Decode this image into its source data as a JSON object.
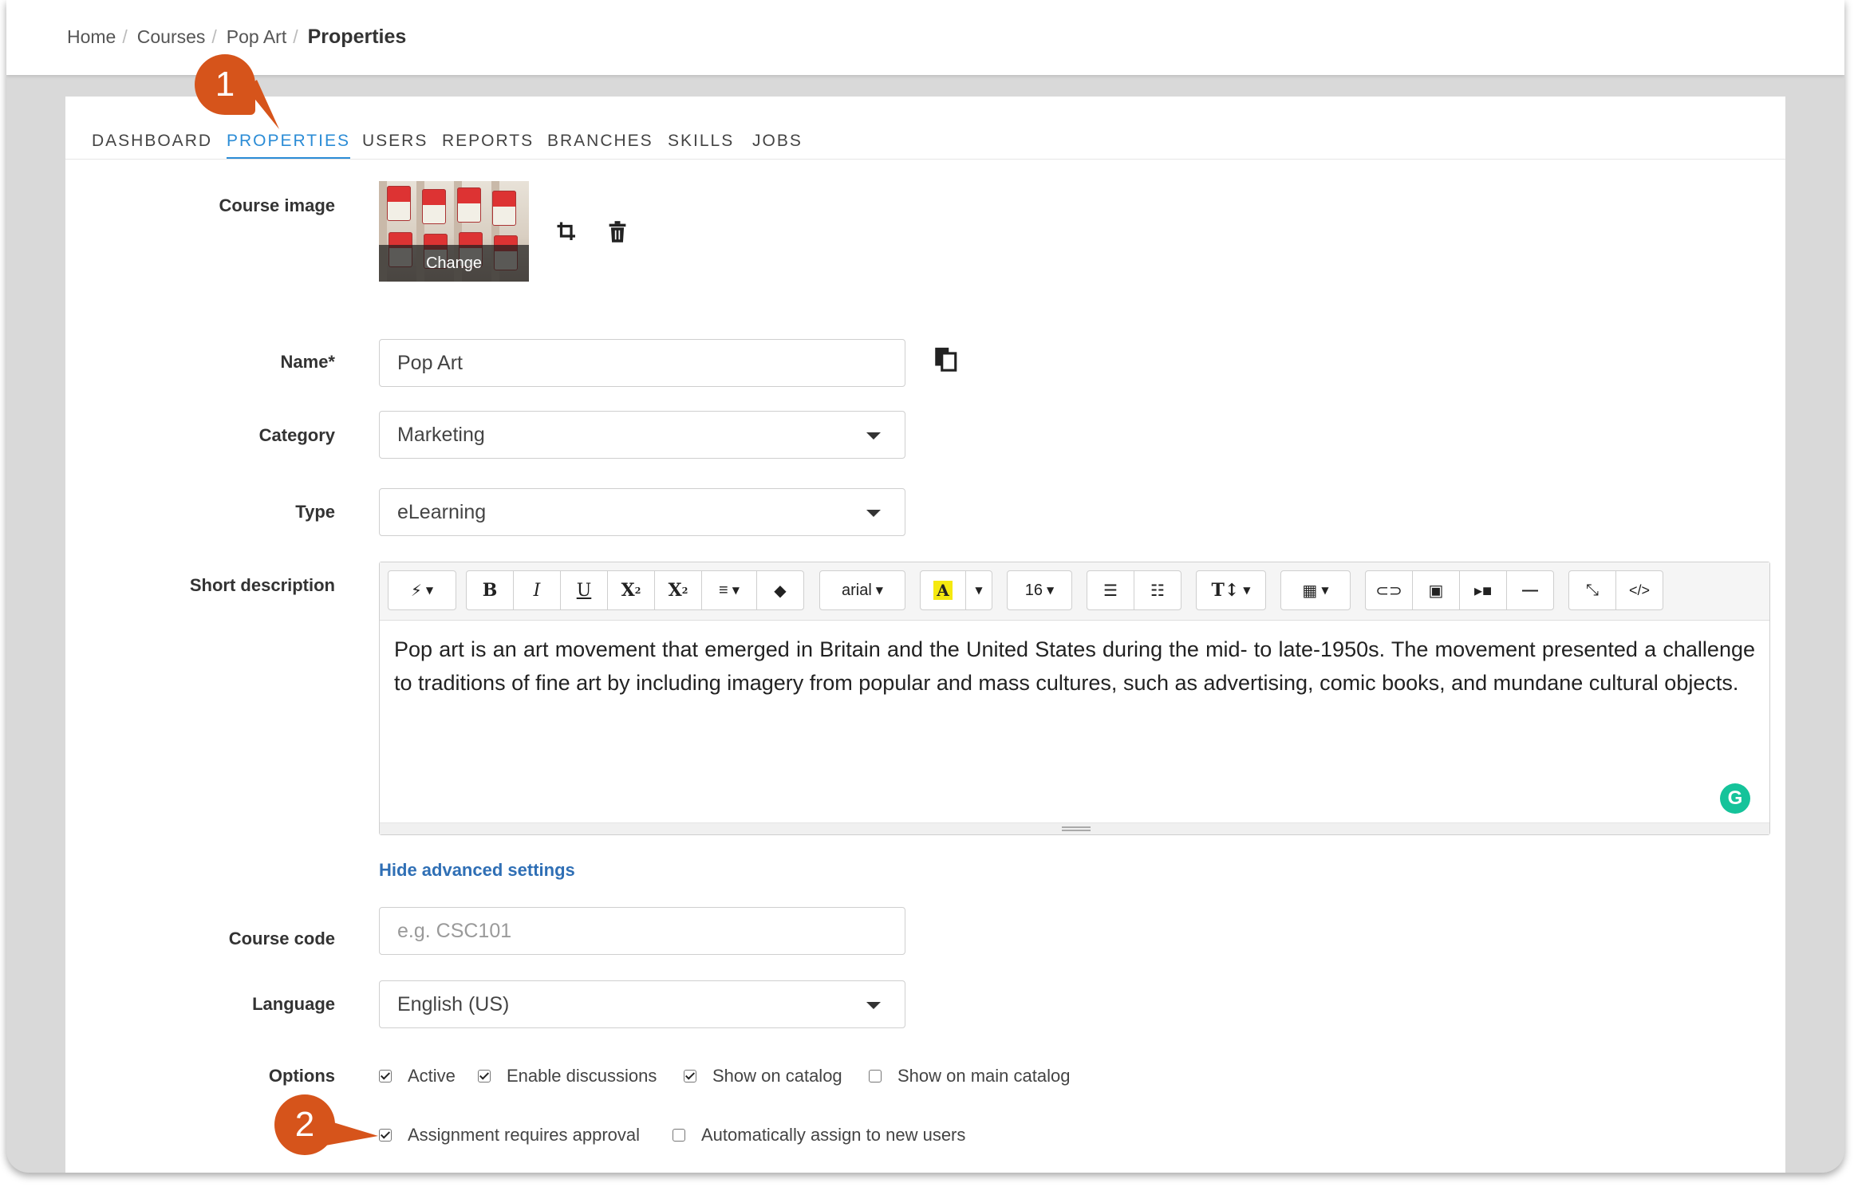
{
  "breadcrumb": {
    "items": [
      "Home",
      "Courses",
      "Pop Art"
    ],
    "current": "Properties"
  },
  "tabs": [
    {
      "label": "DASHBOARD",
      "active": false
    },
    {
      "label": "PROPERTIES",
      "active": true
    },
    {
      "label": "USERS",
      "active": false
    },
    {
      "label": "REPORTS",
      "active": false
    },
    {
      "label": "BRANCHES",
      "active": false
    },
    {
      "label": "SKILLS",
      "active": false
    },
    {
      "label": "JOBS",
      "active": false
    }
  ],
  "form": {
    "course_image": {
      "label": "Course image",
      "change_label": "Change"
    },
    "name": {
      "label": "Name*",
      "value": "Pop Art"
    },
    "category": {
      "label": "Category",
      "value": "Marketing"
    },
    "type": {
      "label": "Type",
      "value": "eLearning"
    },
    "short_description": {
      "label": "Short description",
      "text": "Pop art is an art movement that emerged in Britain and the United States during the mid- to late-1950s. The movement presented a challenge to traditions of fine art by including imagery from popular and mass cultures, such as advertising, comic books, and mundane cultural objects."
    },
    "advanced_link": "Hide advanced settings",
    "course_code": {
      "label": "Course code",
      "placeholder": "e.g. CSC101",
      "value": ""
    },
    "language": {
      "label": "Language",
      "value": "English (US)"
    },
    "options": {
      "label": "Options",
      "items": [
        {
          "label": "Active",
          "checked": true
        },
        {
          "label": "Enable discussions",
          "checked": true
        },
        {
          "label": "Show on catalog",
          "checked": true
        },
        {
          "label": "Show on main catalog",
          "checked": false
        },
        {
          "label": "Assignment requires approval",
          "checked": true
        },
        {
          "label": "Automatically assign to new users",
          "checked": false
        }
      ]
    }
  },
  "toolbar": {
    "font_name": "arial",
    "font_size": "16"
  },
  "markers": [
    "1",
    "2"
  ],
  "colors": {
    "accent": "#2b8cd6",
    "marker": "#d6541b",
    "link": "#2f6fb5",
    "grammarly": "#15c39a"
  }
}
